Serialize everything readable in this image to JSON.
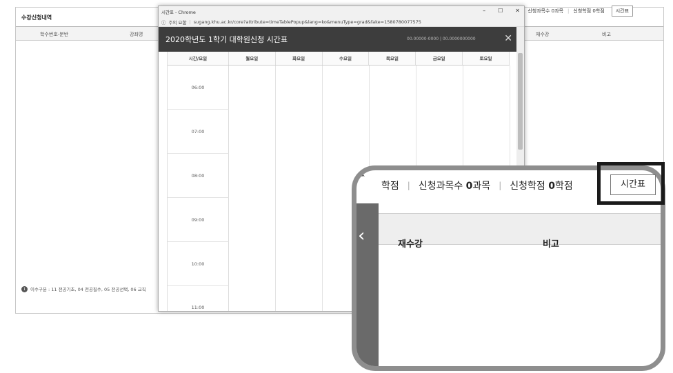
{
  "bg": {
    "title": "수강신청내역",
    "columns": [
      "학수번호-분반",
      "강좌명"
    ],
    "right_columns": [
      "재수강",
      "비고"
    ],
    "note": "이수구분 : 11 전공기초, 04 전공필수, 05 전공선택, 06 교직",
    "toolbar": {
      "item1": "학점",
      "item2": "신청과목수 0과목",
      "item3": "신청학점 0학점",
      "button": "시간표"
    }
  },
  "popup": {
    "window_title": "시간표 - Chrome",
    "address": "sugang.khu.ac.kr/core?attribute=timeTablePopup&lang=ko&menuType=grad&fake=1580780077575",
    "warning": "주의 요함",
    "header": "2020학년도 1학기 대학원신청 시간표",
    "info": "00.00000-0000 | 00.0000000000",
    "close": "✕",
    "ctrl_min": "–",
    "ctrl_max": "☐",
    "ctrl_close": "✕",
    "grid_headers": [
      "시간/요일",
      "월요일",
      "화요일",
      "수요일",
      "목요일",
      "금요일",
      "토요일"
    ],
    "times": [
      "06:00",
      "07:00",
      "08:00",
      "09:00",
      "10:00",
      "11:00"
    ]
  },
  "zoom": {
    "toolbar_item1": "학점",
    "toolbar_item2_pre": "신청과목수 ",
    "toolbar_item2_num": "0",
    "toolbar_item2_post": "과목",
    "toolbar_item3_pre": "신청학점 ",
    "toolbar_item3_num": "0",
    "toolbar_item3_post": "학점",
    "col_retake": "재수강",
    "col_note": "비고",
    "button": "시간표"
  },
  "colors": {
    "popup_header": "#3d3d3d",
    "zoom_border": "#8e8e8e",
    "highlight_border": "#1a1a1a"
  }
}
